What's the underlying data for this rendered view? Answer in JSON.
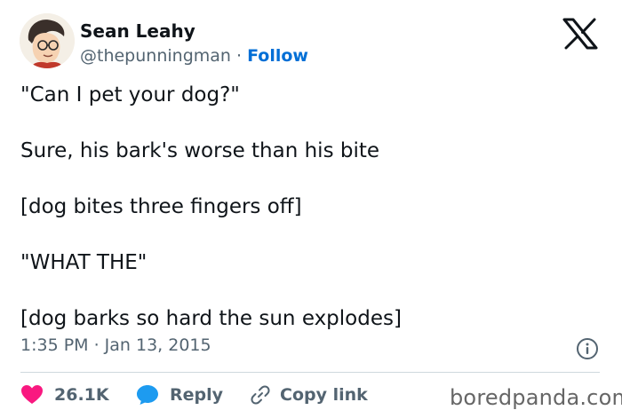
{
  "author": {
    "name": "Sean Leahy",
    "handle": "@thepunningman",
    "separator": " · ",
    "follow_label": "Follow"
  },
  "tweet": {
    "lines": [
      "\"Can I pet your dog?\"",
      "Sure, his bark's worse than his bite",
      "[dog bites three fingers off]",
      "\"WHAT THE\"",
      "[dog barks so hard the sun explodes]"
    ],
    "timestamp": "1:35 PM · Jan 13, 2015"
  },
  "actions": {
    "like_count": "26.1K",
    "reply_label": "Reply",
    "copy_link_label": "Copy link"
  },
  "watermark": "boredpanda.com",
  "icons": {
    "platform": "x-logo-icon",
    "info": "info-icon",
    "like": "heart-icon",
    "reply": "speech-bubble-icon",
    "copy": "link-icon"
  },
  "colors": {
    "text": "#0f1419",
    "secondary": "#536471",
    "follow": "#006fd6",
    "like": "#f91880",
    "reply": "#1d9bf0",
    "divider": "#cfd9de"
  }
}
